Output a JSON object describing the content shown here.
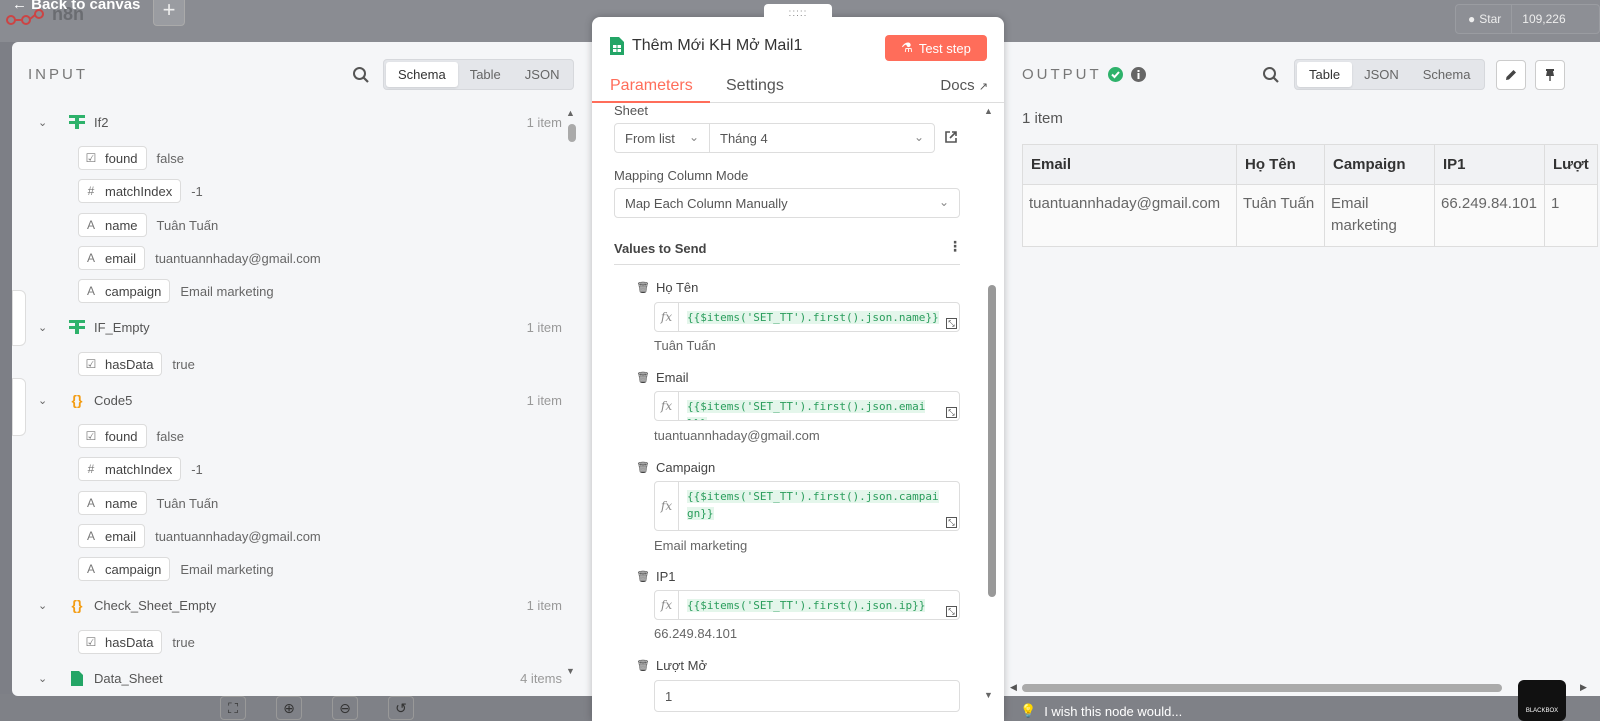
{
  "background": {
    "back_label": "Back to canvas",
    "brand": "n8n",
    "star_label": "Star",
    "star_count": "109,226"
  },
  "input": {
    "title": "INPUT",
    "tabs": [
      "Schema",
      "Table",
      "JSON"
    ],
    "active_tab": "Schema",
    "nodes": [
      {
        "name": "If2",
        "count": "1 item",
        "icon": "if-node-icon"
      },
      {
        "name": "IF_Empty",
        "count": "1 item",
        "icon": "if-node-icon"
      },
      {
        "name": "Code5",
        "count": "1 item",
        "icon": "code-node-icon"
      },
      {
        "name": "Check_Sheet_Empty",
        "count": "1 item",
        "icon": "code-node-icon"
      },
      {
        "name": "Data_Sheet",
        "count": "4 items",
        "icon": "sheet-node-icon"
      }
    ],
    "fields": [
      {
        "type": "☑",
        "key": "found",
        "value": "false"
      },
      {
        "type": "#",
        "key": "matchIndex",
        "value": "-1"
      },
      {
        "type": "A",
        "key": "name",
        "value": "Tuân Tuấn"
      },
      {
        "type": "A",
        "key": "email",
        "value": "tuantuannhaday@gmail.com"
      },
      {
        "type": "A",
        "key": "campaign",
        "value": "Email marketing"
      },
      {
        "type": "☑",
        "key": "hasData",
        "value": "true"
      },
      {
        "type": "☑",
        "key": "found",
        "value": "false"
      },
      {
        "type": "#",
        "key": "matchIndex",
        "value": "-1"
      },
      {
        "type": "A",
        "key": "name",
        "value": "Tuân Tuấn"
      },
      {
        "type": "A",
        "key": "email",
        "value": "tuantuannhaday@gmail.com"
      },
      {
        "type": "A",
        "key": "campaign",
        "value": "Email marketing"
      },
      {
        "type": "☑",
        "key": "hasData",
        "value": "true"
      }
    ]
  },
  "node": {
    "title": "Thêm Mới KH Mở Mail1",
    "test_step": "Test step",
    "tabs": {
      "parameters": "Parameters",
      "settings": "Settings",
      "docs": "Docs"
    },
    "sheet_label": "Sheet",
    "sheet_mode": "From list",
    "sheet_value": "Tháng 4",
    "mapping_label": "Mapping Column Mode",
    "mapping_value": "Map Each Column Manually",
    "values_label": "Values to Send",
    "values": [
      {
        "label": "Họ Tên",
        "expr": "{{$items('SET_TT').first().json.name}}",
        "result": "Tuân Tuấn"
      },
      {
        "label": "Email",
        "expr": "{{$items('SET_TT').first().json.email}}",
        "result": "tuantuannhaday@gmail.com"
      },
      {
        "label": "Campaign",
        "expr": "{{$items('SET_TT').first().json.campaign}}",
        "result": "Email marketing"
      },
      {
        "label": "IP1",
        "expr": "{{$items('SET_TT').first().json.ip}}",
        "result": "66.249.84.101"
      },
      {
        "label": "Lượt Mở",
        "expr": "",
        "result": ""
      }
    ],
    "luot_mo_value": "1"
  },
  "output": {
    "title": "OUTPUT",
    "tabs": [
      "Table",
      "JSON",
      "Schema"
    ],
    "active_tab": "Table",
    "item_count": "1 item",
    "columns": [
      "Email",
      "Họ Tên",
      "Campaign",
      "IP1",
      "Lượt"
    ],
    "row": [
      "tuantuannhaday@gmail.com",
      "Tuân Tuấn",
      "Email marketing",
      "66.249.84.101",
      "1"
    ],
    "wish_label": "I wish this node would...",
    "blackbox_label": "BLACKBOX"
  },
  "colors": {
    "accent": "#ff6d5a",
    "success": "#2eb26b",
    "green_expr": "#2a9d5c"
  }
}
